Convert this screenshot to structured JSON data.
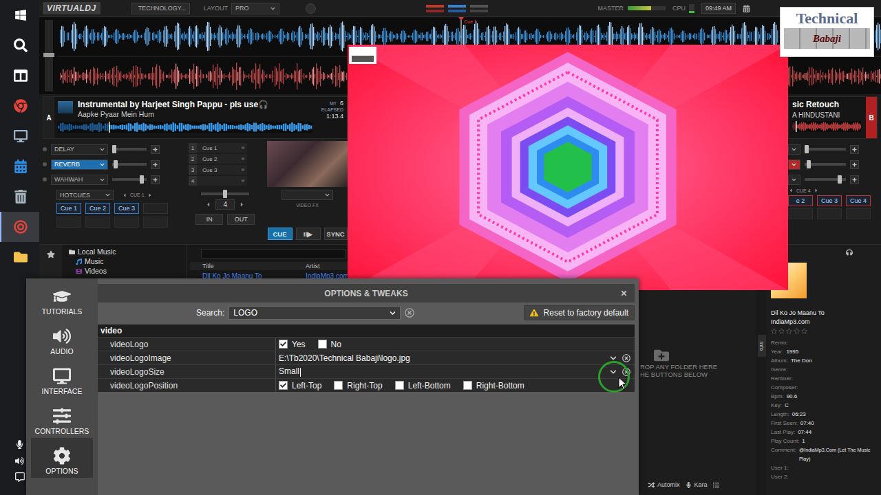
{
  "taskbar": {
    "apps": [
      {
        "selected": false
      },
      {
        "selected": false
      },
      {
        "selected": false
      },
      {
        "selected": false
      },
      {
        "selected": false
      },
      {
        "selected": false
      },
      {
        "selected": false
      },
      {
        "selected": true
      },
      {
        "selected": false
      }
    ]
  },
  "topbar": {
    "logo": "VIRTUALDJ",
    "skin": "TECHNOLOGY...",
    "layout_label": "LAYOUT",
    "layout": "PRO",
    "master_label": "MASTER",
    "master_level": 0.62,
    "cpu_label": "CPU",
    "cpu_level": 0.2,
    "clock": "09:49 AM"
  },
  "waveform": {
    "cue": "Cue 1"
  },
  "deck_a": {
    "letter": "A",
    "title": "Instrumental by Harjeet Singh Pappu - pls use🎧",
    "artist": "Aapke Pyaar Mein Hum",
    "mt": "MT",
    "digit": "6",
    "elapsed_label": "ELAPSED",
    "elapsed": "1:13.4",
    "progress": 0.2,
    "effects": [
      {
        "name": "DELAY",
        "selected": false,
        "level": 0.05
      },
      {
        "name": "REVERB",
        "selected": true,
        "level": 0.1
      },
      {
        "name": "WAHWAH",
        "selected": false,
        "level": 0.85
      }
    ],
    "hotcues": [
      {
        "number": "1",
        "label": "Cue 1"
      },
      {
        "number": "2",
        "label": "Cue 2"
      },
      {
        "number": "3",
        "label": "Cue 3"
      },
      {
        "number": "4",
        "label": ""
      }
    ],
    "pads_mode": "HOTCUES",
    "pads_page": "CUE 1",
    "pads": [
      {
        "label": "Cue 1",
        "set": true
      },
      {
        "label": "Cue 2",
        "set": true
      },
      {
        "label": "Cue 3",
        "set": true
      },
      {
        "label": "",
        "set": false
      }
    ],
    "video_fx": "VIDEO FX",
    "loop": "4",
    "loop_in": "IN",
    "loop_out": "OUT",
    "cue": "CUE",
    "play": "II▶",
    "sync": "SYNC"
  },
  "deck_b": {
    "letter": "B",
    "title": "sic Retouch",
    "artist": "A HINDUSTANI",
    "effects": [
      {
        "selected": false,
        "level": 0.05
      },
      {
        "selected": true,
        "level": 0.1
      },
      {
        "selected": false,
        "level": 0.85
      }
    ],
    "pads_page": "CUE 4",
    "pads": [
      {
        "label": "e 2",
        "set": true
      },
      {
        "label": "Cue 3",
        "set": true
      },
      {
        "label": "Cue 4",
        "set": true
      }
    ]
  },
  "browser": {
    "tree": [
      {
        "label": "Local Music",
        "depth": 0
      },
      {
        "label": "Music",
        "depth": 1
      },
      {
        "label": "Videos",
        "depth": 1
      }
    ],
    "columns": [
      "Title",
      "Artist"
    ],
    "rows": [
      {
        "title": "Dil Ko Jo Maanu To",
        "artist": "IndiaMp3.com",
        "selected": false
      }
    ]
  },
  "dropzone": {
    "lines": [
      "ROP ANY FOLDER HERE",
      "HE BUTTONS BELOW"
    ],
    "automix": "Automix",
    "karaoke": "Kara"
  },
  "info": {
    "tab": "Info",
    "title": "Dil Ko Jo Maanu To",
    "artist": "IndiaMp3.com",
    "stars": 0,
    "fields": [
      {
        "label": "Remix:",
        "value": ""
      },
      {
        "label": "Year:",
        "value": "1995"
      },
      {
        "label": "Album:",
        "value": "The Don"
      },
      {
        "label": "Genre:",
        "value": ""
      },
      {
        "label": "Remixer:",
        "value": ""
      },
      {
        "label": "Composer:",
        "value": ""
      },
      {
        "label": "Bpm:",
        "value": "90.6"
      },
      {
        "label": "Key:",
        "value": "C"
      },
      {
        "label": "Length:",
        "value": "06:23"
      },
      {
        "label": "First Seen:",
        "value": "07:40"
      },
      {
        "label": "Last Play:",
        "value": "07:44"
      },
      {
        "label": "Play Count:",
        "value": "1"
      },
      {
        "label": "Comment:",
        "value": "@IndiaMp3.Com (Let The Music Play)"
      },
      {
        "label": "User 1:",
        "value": ""
      },
      {
        "label": "User 2:",
        "value": ""
      }
    ]
  },
  "dialog": {
    "title": "OPTIONS & TWEAKS",
    "sidebar": [
      {
        "label": "TUTORIALS",
        "selected": false
      },
      {
        "label": "AUDIO",
        "selected": false
      },
      {
        "label": "INTERFACE",
        "selected": false
      },
      {
        "label": "CONTROLLERS",
        "selected": false
      },
      {
        "label": "OPTIONS",
        "selected": true
      }
    ],
    "search_label": "Search:",
    "search": "LOGO",
    "reset": "Reset to factory default",
    "group": "video",
    "settings": [
      {
        "name": "videoLogo",
        "kind": "checks",
        "value": "",
        "editing": false,
        "options": [
          {
            "label": "Yes",
            "checked": true
          },
          {
            "label": "No",
            "checked": false
          }
        ]
      },
      {
        "name": "videoLogoImage",
        "kind": "dropdown",
        "value": "E:\\Tb2020\\Technical Babaji\\logo.jpg",
        "editing": false,
        "options": []
      },
      {
        "name": "videoLogoSize",
        "kind": "dropdown",
        "value": "Small",
        "editing": true,
        "options": []
      },
      {
        "name": "videoLogoPosition",
        "kind": "checks",
        "value": "",
        "editing": false,
        "options": [
          {
            "label": "Left-Top",
            "checked": true
          },
          {
            "label": "Right-Top",
            "checked": false
          },
          {
            "label": "Left-Bottom",
            "checked": false
          },
          {
            "label": "Right-Bottom",
            "checked": false
          }
        ]
      }
    ]
  },
  "watermark": {
    "line1": "Technical",
    "line2": "Babaji"
  }
}
